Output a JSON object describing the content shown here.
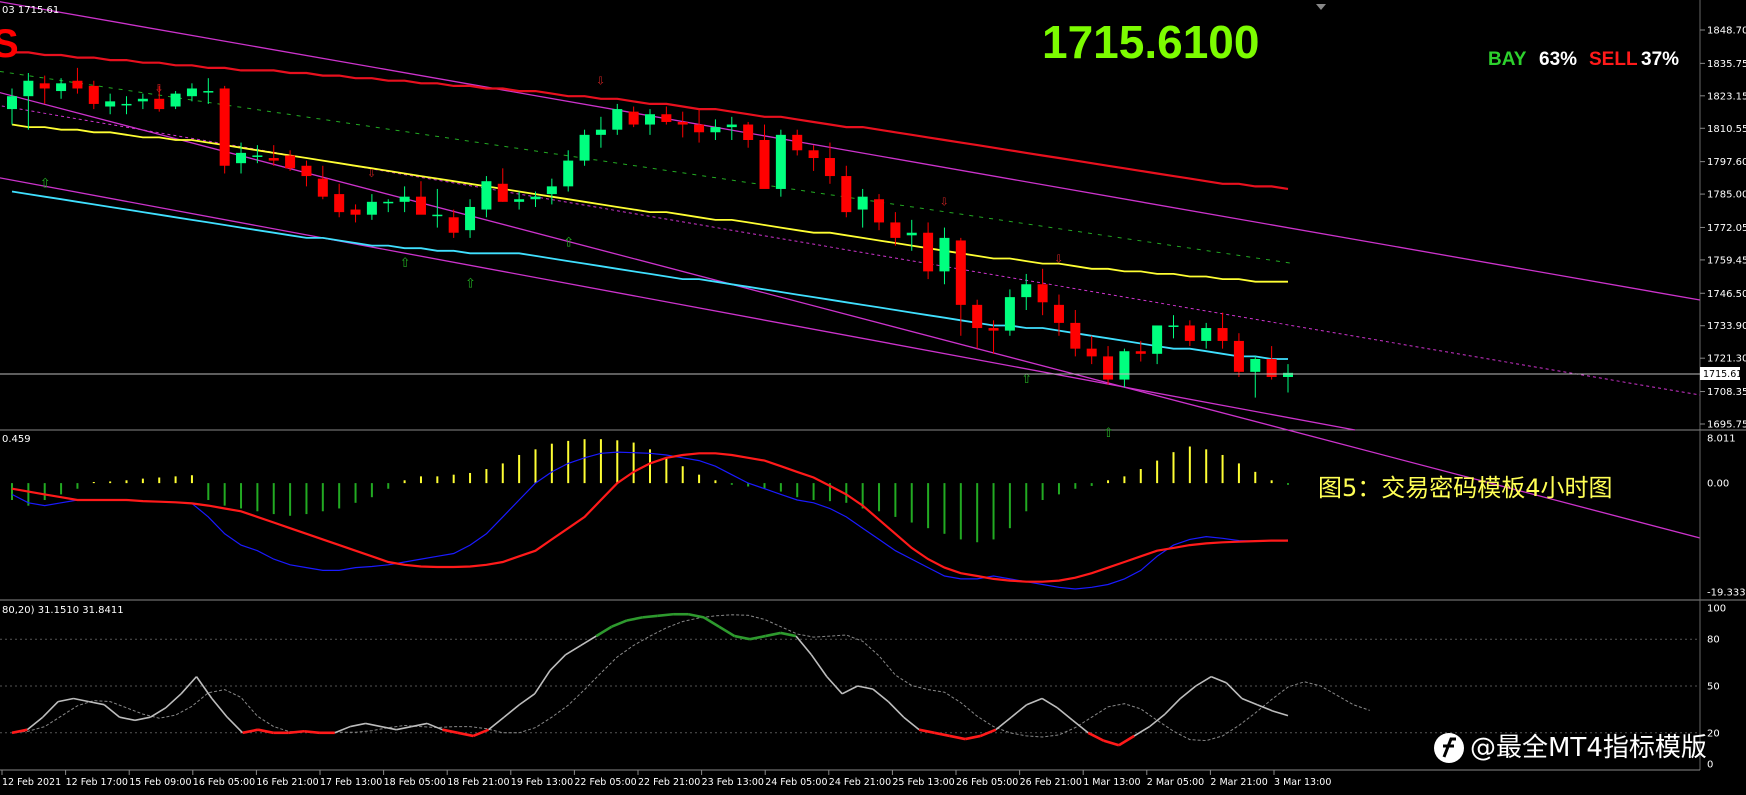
{
  "header": {
    "info_left": "03 1715.61",
    "corner_mark": "S",
    "big_price": "1715.6100",
    "sentiment": {
      "bay_label": "BAY",
      "bay_pct": "63%",
      "sell_label": "SELL",
      "sell_pct": "37%"
    }
  },
  "price_pane": {
    "y_ticks": [
      "1848.70",
      "1835.75",
      "1823.15",
      "1810.55",
      "1797.60",
      "1785.00",
      "1772.05",
      "1759.45",
      "1746.50",
      "1733.90",
      "1721.30",
      "1708.35",
      "1695.75"
    ],
    "current_price_label": "1715.61"
  },
  "macd_pane": {
    "label": "0.459",
    "y_ticks": [
      "8.011",
      "0.00",
      "-19.333"
    ],
    "caption": "图5：交易密码模板4小时图"
  },
  "stoch_pane": {
    "label": "80,20) 31.1510 31.8411",
    "y_ticks": [
      "100",
      "80",
      "50",
      "20",
      "0"
    ]
  },
  "x_ticks": [
    "12 Feb 2021",
    "12 Feb 17:00",
    "15 Feb 09:00",
    "16 Feb 05:00",
    "16 Feb 21:00",
    "17 Feb 13:00",
    "18 Feb 05:00",
    "18 Feb 21:00",
    "19 Feb 13:00",
    "22 Feb 05:00",
    "22 Feb 21:00",
    "23 Feb 13:00",
    "24 Feb 05:00",
    "24 Feb 21:00",
    "25 Feb 13:00",
    "26 Feb 05:00",
    "26 Feb 21:00",
    "1 Mar 13:00",
    "2 Mar 05:00",
    "2 Mar 21:00",
    "3 Mar 13:00"
  ],
  "watermark": "@最全MT4指标模版",
  "colors": {
    "bull": "#00ff7f",
    "bear": "#ff0000",
    "ma_red": "#e8101e",
    "ma_yellow": "#ffff33",
    "ma_cyan": "#40e0ff",
    "channel": "#cc33cc",
    "macd_pos": "#ffff33",
    "macd_neg": "#22aa22",
    "signal": "#ff1a1a",
    "macd_line": "#1a1aff",
    "stoch_main": "#bdbdbd",
    "stoch_sig": "#888888"
  },
  "chart_data": [
    {
      "type": "candlestick",
      "title": "XAUUSD H4",
      "ylim": [
        1695.75,
        1850.5
      ],
      "candles": [
        [
          1818,
          1826,
          1812,
          1823
        ],
        [
          1823,
          1832,
          1810,
          1829
        ],
        [
          1828,
          1831,
          1820,
          1826
        ],
        [
          1825,
          1830,
          1822,
          1828
        ],
        [
          1829,
          1834,
          1824,
          1826
        ],
        [
          1827,
          1829,
          1818,
          1820
        ],
        [
          1819,
          1824,
          1816,
          1821
        ],
        [
          1820,
          1823,
          1816,
          1820
        ],
        [
          1821,
          1824,
          1818,
          1822
        ],
        [
          1822,
          1827,
          1817,
          1818
        ],
        [
          1819,
          1825,
          1818,
          1824
        ],
        [
          1823,
          1828,
          1821,
          1826
        ],
        [
          1825,
          1830,
          1820,
          1825
        ],
        [
          1826,
          1827,
          1793,
          1796
        ],
        [
          1797,
          1805,
          1793,
          1801
        ],
        [
          1800,
          1804,
          1797,
          1800
        ],
        [
          1799,
          1804,
          1796,
          1798
        ],
        [
          1800,
          1802,
          1794,
          1795
        ],
        [
          1796,
          1798,
          1788,
          1792
        ],
        [
          1791,
          1796,
          1783,
          1784
        ],
        [
          1785,
          1789,
          1776,
          1778
        ],
        [
          1779,
          1781,
          1774,
          1777
        ],
        [
          1777,
          1785,
          1775,
          1782
        ],
        [
          1782,
          1783,
          1778,
          1782
        ],
        [
          1782,
          1788,
          1778,
          1784
        ],
        [
          1784,
          1790,
          1780,
          1777
        ],
        [
          1777,
          1787,
          1772,
          1777
        ],
        [
          1776,
          1779,
          1768,
          1770
        ],
        [
          1771,
          1783,
          1768,
          1780
        ],
        [
          1779,
          1792,
          1776,
          1790
        ],
        [
          1789,
          1795,
          1782,
          1782
        ],
        [
          1782,
          1786,
          1779,
          1783
        ],
        [
          1783,
          1786,
          1780,
          1784
        ],
        [
          1785,
          1791,
          1781,
          1788
        ],
        [
          1788,
          1802,
          1786,
          1798
        ],
        [
          1798,
          1810,
          1796,
          1808
        ],
        [
          1808,
          1815,
          1803,
          1810
        ],
        [
          1810,
          1820,
          1808,
          1818
        ],
        [
          1817,
          1819,
          1811,
          1812
        ],
        [
          1812,
          1818,
          1808,
          1816
        ],
        [
          1816,
          1819,
          1812,
          1813
        ],
        [
          1813,
          1817,
          1807,
          1812
        ],
        [
          1812,
          1818,
          1805,
          1809
        ],
        [
          1809,
          1814,
          1806,
          1811
        ],
        [
          1811,
          1815,
          1806,
          1812
        ],
        [
          1812,
          1813,
          1803,
          1806
        ],
        [
          1806,
          1812,
          1797,
          1787
        ],
        [
          1787,
          1810,
          1784,
          1808
        ],
        [
          1808,
          1810,
          1800,
          1802
        ],
        [
          1802,
          1804,
          1794,
          1799
        ],
        [
          1799,
          1805,
          1789,
          1792
        ],
        [
          1792,
          1796,
          1776,
          1778
        ],
        [
          1779,
          1787,
          1772,
          1784
        ],
        [
          1783,
          1785,
          1771,
          1774
        ],
        [
          1774,
          1778,
          1765,
          1768
        ],
        [
          1769,
          1775,
          1763,
          1770
        ],
        [
          1770,
          1774,
          1752,
          1755
        ],
        [
          1755,
          1772,
          1750,
          1768
        ],
        [
          1767,
          1768,
          1730,
          1742
        ],
        [
          1742,
          1744,
          1725,
          1733
        ],
        [
          1733,
          1736,
          1723,
          1732
        ],
        [
          1732,
          1748,
          1730,
          1745
        ],
        [
          1745,
          1754,
          1740,
          1750
        ],
        [
          1750,
          1756,
          1738,
          1743
        ],
        [
          1742,
          1746,
          1730,
          1735
        ],
        [
          1735,
          1740,
          1722,
          1725
        ],
        [
          1725,
          1730,
          1719,
          1722
        ],
        [
          1722,
          1726,
          1711,
          1713
        ],
        [
          1713,
          1725,
          1710,
          1724
        ],
        [
          1724,
          1728,
          1720,
          1723
        ],
        [
          1723,
          1734,
          1719,
          1734
        ],
        [
          1734,
          1738,
          1729,
          1734
        ],
        [
          1734,
          1736,
          1726,
          1728
        ],
        [
          1728,
          1735,
          1725,
          1733
        ],
        [
          1733,
          1739,
          1725,
          1728
        ],
        [
          1728,
          1731,
          1714,
          1716
        ],
        [
          1716,
          1722,
          1706,
          1721
        ],
        [
          1721,
          1726,
          1713,
          1714
        ],
        [
          1714,
          1719,
          1708,
          1715.61
        ]
      ],
      "ma_slow": [
        1840,
        1840,
        1839,
        1839,
        1838,
        1838,
        1837,
        1837,
        1836,
        1836,
        1835,
        1835,
        1834,
        1834,
        1833,
        1833,
        1833,
        1832,
        1832,
        1831,
        1831,
        1830,
        1830,
        1829,
        1829,
        1828,
        1828,
        1827,
        1827,
        1826,
        1826,
        1825,
        1825,
        1824,
        1823,
        1823,
        1822,
        1822,
        1821,
        1820,
        1820,
        1819,
        1818,
        1818,
        1817,
        1816,
        1815,
        1815,
        1814,
        1813,
        1812,
        1811,
        1811,
        1810,
        1809,
        1808,
        1807,
        1806,
        1805,
        1804,
        1803,
        1802,
        1801,
        1800,
        1799,
        1798,
        1797,
        1796,
        1795,
        1794,
        1793,
        1792,
        1791,
        1790,
        1789,
        1789,
        1788,
        1788,
        1787
      ],
      "ma_mid": [
        1812,
        1811,
        1811,
        1810,
        1810,
        1809,
        1809,
        1808,
        1807,
        1807,
        1806,
        1806,
        1805,
        1804,
        1803,
        1802,
        1801,
        1800,
        1799,
        1798,
        1797,
        1796,
        1795,
        1794,
        1793,
        1792,
        1791,
        1790,
        1789,
        1788,
        1787,
        1786,
        1785,
        1784,
        1783,
        1782,
        1781,
        1780,
        1779,
        1778,
        1778,
        1777,
        1776,
        1775,
        1775,
        1774,
        1773,
        1772,
        1771,
        1770,
        1770,
        1769,
        1768,
        1767,
        1766,
        1765,
        1764,
        1763,
        1762,
        1761,
        1760,
        1760,
        1759,
        1758,
        1758,
        1757,
        1756,
        1756,
        1755,
        1755,
        1754,
        1754,
        1753,
        1753,
        1752,
        1752,
        1751,
        1751,
        1751
      ],
      "ma_fast": [
        1786,
        1785,
        1784,
        1783,
        1782,
        1781,
        1780,
        1779,
        1778,
        1777,
        1776,
        1775,
        1774,
        1773,
        1772,
        1771,
        1770,
        1769,
        1768,
        1768,
        1767,
        1766,
        1765,
        1765,
        1764,
        1764,
        1763,
        1763,
        1762,
        1762,
        1762,
        1762,
        1761,
        1760,
        1759,
        1758,
        1757,
        1756,
        1755,
        1754,
        1753,
        1752,
        1752,
        1751,
        1750,
        1749,
        1748,
        1747,
        1746,
        1745,
        1744,
        1743,
        1742,
        1741,
        1740,
        1739,
        1738,
        1737,
        1736,
        1735,
        1734,
        1734,
        1733,
        1733,
        1732,
        1731,
        1730,
        1729,
        1728,
        1727,
        1726,
        1725,
        1725,
        1724,
        1723,
        1722,
        1722,
        1721,
        1721
      ]
    },
    {
      "type": "bar",
      "title": "MACD",
      "ylim": [
        -19.333,
        8.011
      ],
      "values": [
        -3,
        -4,
        -3,
        -2,
        -1,
        0.2,
        0.3,
        0.5,
        0.8,
        1,
        1.2,
        1.4,
        -3,
        -4,
        -4.5,
        -5,
        -5.5,
        -5.8,
        -5.5,
        -5,
        -4.5,
        -3.5,
        -2.5,
        -1,
        0.5,
        1.2,
        1.2,
        1.5,
        1.8,
        2.5,
        3.5,
        5,
        6,
        7,
        7.5,
        7.8,
        7.8,
        7.6,
        7.2,
        6,
        4.5,
        3,
        1.5,
        0.5,
        -0.3,
        -0.6,
        -1,
        -1.5,
        -2.5,
        -3,
        -3.2,
        -3.5,
        -4.5,
        -5,
        -6,
        -7,
        -8,
        -9,
        -10,
        -10.5,
        -10,
        -8,
        -5,
        -3,
        -2,
        -1,
        -0.5,
        0.5,
        1.2,
        2.5,
        4,
        5.5,
        6.5,
        6,
        5,
        3.5,
        2,
        0.5,
        -0.3
      ],
      "signal": [
        -1,
        -1.5,
        -2,
        -2.5,
        -3,
        -3,
        -3,
        -3,
        -3.2,
        -3.3,
        -3.4,
        -3.6,
        -4,
        -4.5,
        -5,
        -6,
        -7,
        -8,
        -9,
        -10,
        -11,
        -12,
        -13,
        -14,
        -14.5,
        -14.8,
        -14.9,
        -14.9,
        -14.8,
        -14.5,
        -14,
        -13,
        -12,
        -10,
        -8,
        -6,
        -3,
        0,
        2,
        3.5,
        4.5,
        5,
        5.3,
        5.3,
        5,
        4.5,
        4,
        3,
        2,
        1,
        -0.5,
        -2,
        -4,
        -6.5,
        -9,
        -11.5,
        -13.5,
        -15,
        -16,
        -16.5,
        -17,
        -17.3,
        -17.5,
        -17.5,
        -17.3,
        -16.8,
        -16,
        -15,
        -14,
        -13,
        -12,
        -11.5,
        -11,
        -10.7,
        -10.5,
        -10.4,
        -10.3,
        -10.2,
        -10.2
      ],
      "macd_line": [
        -2,
        -3.5,
        -4,
        -3.5,
        -3,
        -3,
        -3,
        -3,
        -3.2,
        -3.3,
        -3.4,
        -3.6,
        -6,
        -9,
        -11,
        -12,
        -13.5,
        -14.5,
        -15,
        -15.5,
        -15.5,
        -15,
        -14.8,
        -14.5,
        -14,
        -13.5,
        -13,
        -12.5,
        -11,
        -9,
        -6,
        -3,
        0,
        2,
        3.5,
        4.5,
        5.3,
        5.5,
        5.4,
        5.3,
        5,
        4.5,
        4,
        3,
        1.5,
        0,
        -1,
        -2,
        -3,
        -3.5,
        -4.5,
        -6,
        -8,
        -10,
        -12,
        -13.5,
        -15,
        -16.5,
        -17,
        -17,
        -16.5,
        -17,
        -17.5,
        -18,
        -18.5,
        -18.8,
        -18.5,
        -18,
        -17,
        -15.5,
        -13,
        -11,
        -10,
        -9.5,
        -9.8,
        -10.2,
        -10.3,
        -10.2,
        -10.1
      ]
    },
    {
      "type": "line",
      "title": "Stochastic",
      "ylim": [
        0,
        100
      ],
      "main": [
        20,
        22,
        30,
        40,
        42,
        40,
        38,
        30,
        28,
        30,
        36,
        45,
        56,
        42,
        30,
        20,
        22,
        20,
        20,
        21,
        20,
        20,
        24,
        26,
        24,
        22,
        24,
        26,
        22,
        20,
        18,
        22,
        30,
        38,
        45,
        60,
        70,
        76,
        82,
        88,
        92,
        94,
        95,
        96,
        96,
        94,
        88,
        82,
        80,
        82,
        84,
        82,
        70,
        56,
        45,
        50,
        48,
        40,
        30,
        22,
        20,
        18,
        16,
        18,
        22,
        30,
        38,
        42,
        36,
        28,
        20,
        15,
        12,
        18,
        24,
        32,
        42,
        50,
        56,
        52,
        42,
        38,
        34,
        31
      ]
    }
  ]
}
